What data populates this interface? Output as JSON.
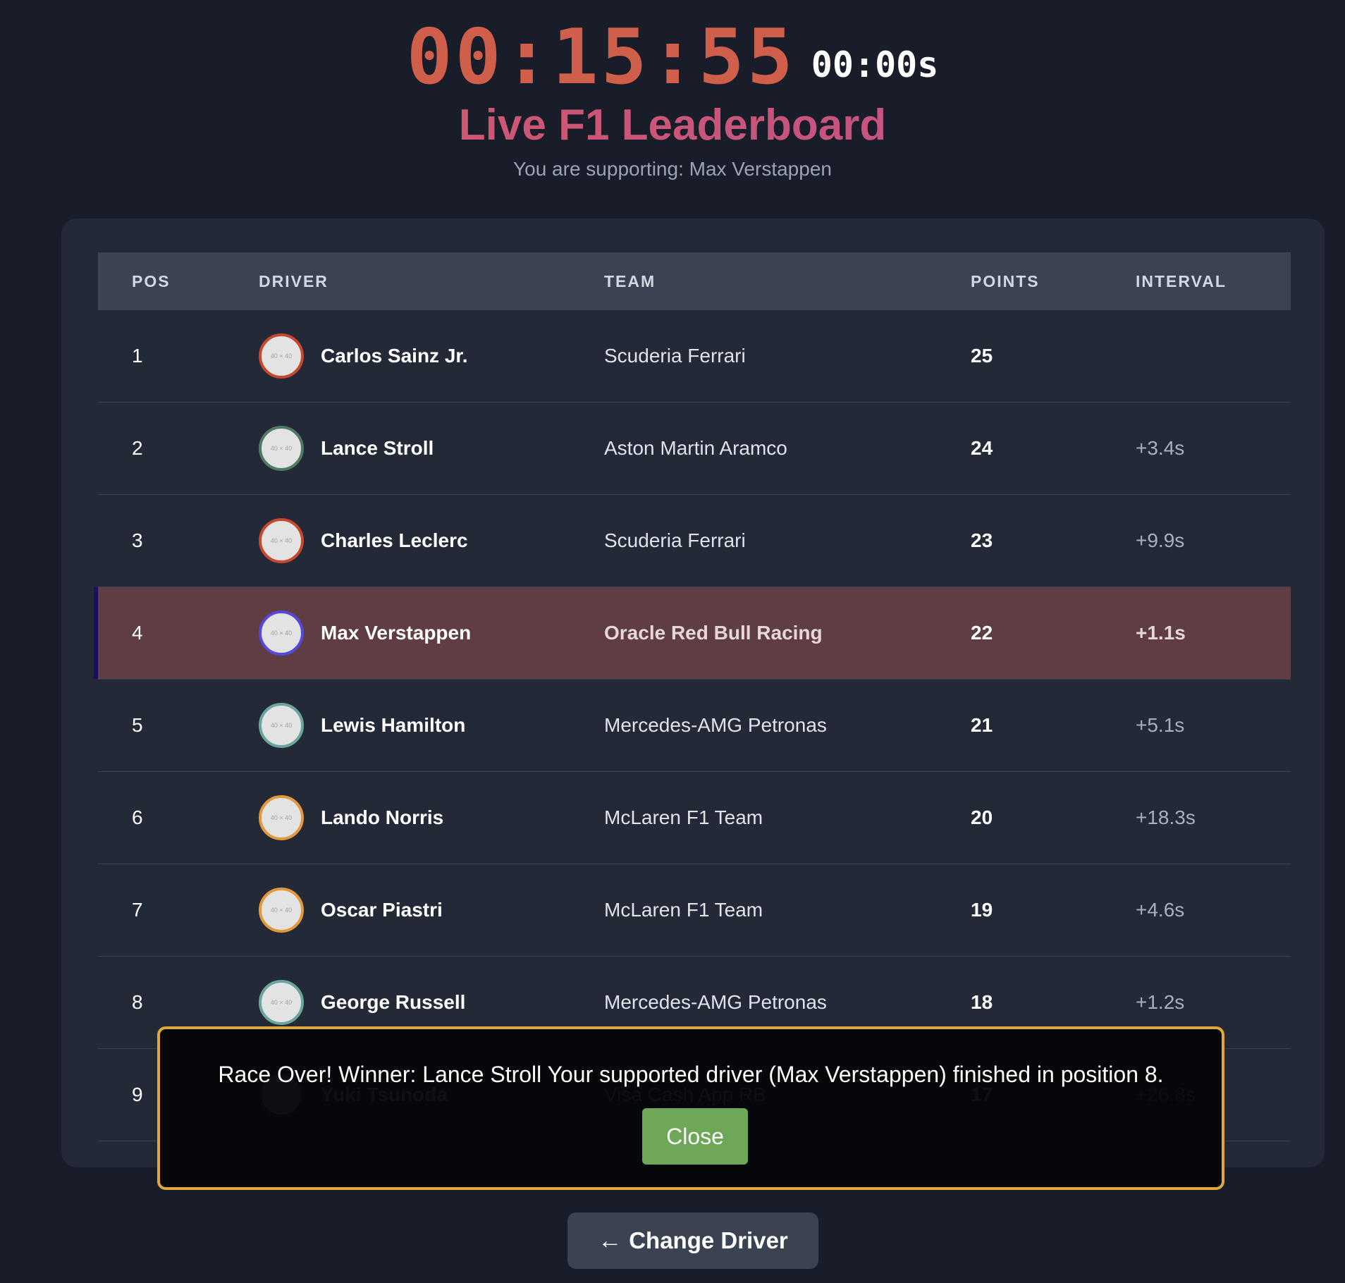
{
  "timer": {
    "main": "00:15:55",
    "sub": "00:00s"
  },
  "header": {
    "title": "Live F1 Leaderboard",
    "subtitle": "You are supporting: Max Verstappen"
  },
  "table": {
    "columns": [
      "POS",
      "DRIVER",
      "TEAM",
      "POINTS",
      "INTERVAL"
    ],
    "avatar_placeholder": "40 × 40",
    "rows": [
      {
        "pos": "1",
        "driver": "Carlos Sainz Jr.",
        "team": "Scuderia Ferrari",
        "points": "25",
        "interval": "",
        "color": "#c8472f"
      },
      {
        "pos": "2",
        "driver": "Lance Stroll",
        "team": "Aston Martin Aramco",
        "points": "24",
        "interval": "+3.4s",
        "color": "#4f7a66"
      },
      {
        "pos": "3",
        "driver": "Charles Leclerc",
        "team": "Scuderia Ferrari",
        "points": "23",
        "interval": "+9.9s",
        "color": "#c8472f"
      },
      {
        "pos": "4",
        "driver": "Max Verstappen",
        "team": "Oracle Red Bull Racing",
        "points": "22",
        "interval": "+1.1s",
        "color": "#5549dd"
      },
      {
        "pos": "5",
        "driver": "Lewis Hamilton",
        "team": "Mercedes-AMG Petronas",
        "points": "21",
        "interval": "+5.1s",
        "color": "#6aa59d"
      },
      {
        "pos": "6",
        "driver": "Lando Norris",
        "team": "McLaren F1 Team",
        "points": "20",
        "interval": "+18.3s",
        "color": "#e2993b"
      },
      {
        "pos": "7",
        "driver": "Oscar Piastri",
        "team": "McLaren F1 Team",
        "points": "19",
        "interval": "+4.6s",
        "color": "#e2993b"
      },
      {
        "pos": "8",
        "driver": "George Russell",
        "team": "Mercedes-AMG Petronas",
        "points": "18",
        "interval": "+1.2s",
        "color": "#6aa59d"
      },
      {
        "pos": "9",
        "driver": "Yuki Tsunoda",
        "team": "Visa Cash App RB",
        "points": "17",
        "interval": "+26.8s",
        "color": "#3b4a85"
      }
    ]
  },
  "modal": {
    "message": "Race Over! Winner: Lance Stroll Your supported driver (Max Verstappen) finished in position 8.",
    "close_label": "Close"
  },
  "footer": {
    "change_driver_label": "Change Driver",
    "arrow_icon": "←"
  }
}
